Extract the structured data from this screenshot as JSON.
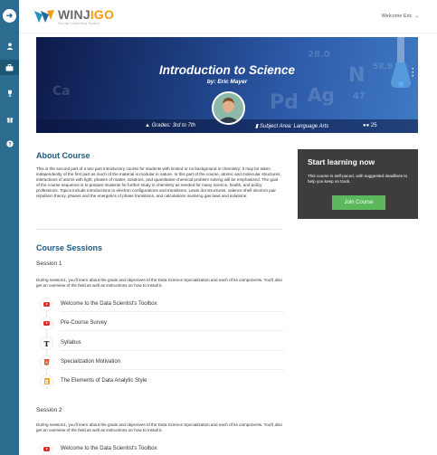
{
  "header": {
    "logo_name_part1": "WINJ",
    "logo_name_part2": "IGO",
    "logo_tagline": "Social Learning Space",
    "welcome": "Welcome Eric",
    "brand_colors": {
      "blue": "#2c6c8f",
      "orange": "#f39c12"
    }
  },
  "sidebar": {
    "items": [
      {
        "icon": "arrow-right-icon"
      },
      {
        "icon": "user-icon"
      },
      {
        "icon": "briefcase-icon"
      },
      {
        "icon": "trophy-icon"
      },
      {
        "icon": "gift-icon"
      },
      {
        "icon": "question-icon"
      }
    ]
  },
  "hero": {
    "title": "Introduction to Science",
    "byline": "by: Eric Mayer",
    "grades": "Grades: 3rd to 7th",
    "subject": "Subject Area: Language Arts",
    "participants": "25"
  },
  "about": {
    "heading": "About Course",
    "text": "This is the second part of a two part introductory course for students with limited or no background in chemistry; it may be taken independently of the first part as much of the material is modular in nature. In this part of the course, atomic and molecular structures, interactions of atoms with light, phases of matter, solutions, and quantitative chemical problem solving will be emphasized. The goal of the course sequence is to prepare students for further study in chemistry as needed for many science, health, and policy professions. Topics include introductions to electron configurations and transitions, Lewis dot structures, valence shell electron pair repulsion theory, phases and the energetics of phase transitions, and calculations involving gas laws and solutions."
  },
  "start_card": {
    "title": "Start learning now",
    "text": "This course is self-paced, with suggested deadlines to help you keep on track.",
    "button": "Join Course"
  },
  "sessions": {
    "heading": "Course Sessions",
    "list": [
      {
        "label": "Session 1",
        "description": "During session1, you'll learn about the goals and objectives of the Data Science Specialization and each of its components. You'll also get an overview of the field as well as instructions on how to install it.",
        "modules": [
          {
            "icon": "youtube-icon",
            "title": "Welcome to the Data Scientist's Toolbox"
          },
          {
            "icon": "youtube-icon",
            "title": "Pre-Course Survey"
          },
          {
            "icon": "text-icon",
            "title": "Syllabus"
          },
          {
            "icon": "html5-icon",
            "title": "Specialization Motivation"
          },
          {
            "icon": "document-icon",
            "title": "The Elements of Data Analytic Style"
          }
        ]
      },
      {
        "label": "Session 2",
        "description": "During session1, you'll learn about the goals and objectives of the Data Science Specialization and each of its components. You'll also get an overview of the field as well as instructions on how to install it.",
        "modules": [
          {
            "icon": "youtube-icon",
            "title": "Welcome to the Data Scientist's Toolbox"
          }
        ]
      }
    ]
  }
}
